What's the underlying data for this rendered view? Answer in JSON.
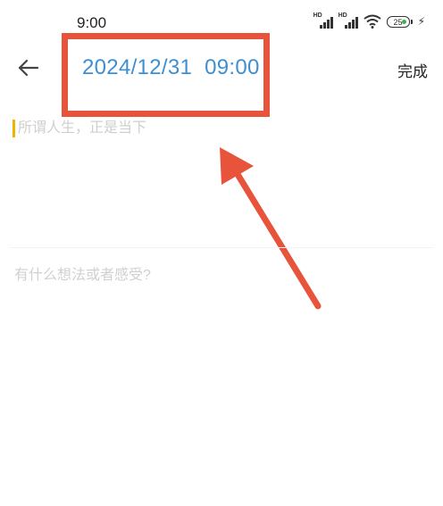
{
  "status_bar": {
    "time": "9:00",
    "signal_label_1": "HD",
    "signal_label_2": "HD",
    "battery_level": "25",
    "icons": [
      "signal-hd-icon",
      "signal-hd-icon",
      "wifi-icon",
      "battery-icon",
      "charging-icon"
    ]
  },
  "header": {
    "date": "2024/12/31",
    "time": "09:00",
    "done_label": "完成",
    "back_icon": "back-arrow-icon"
  },
  "editor": {
    "title_placeholder": "所谓人生，正是当下",
    "content_placeholder": "有什么想法或者感受?"
  },
  "annotation": {
    "color": "#e8533b"
  },
  "colors": {
    "accent_blue": "#3d8fd1",
    "caret_yellow": "#f0b400"
  }
}
